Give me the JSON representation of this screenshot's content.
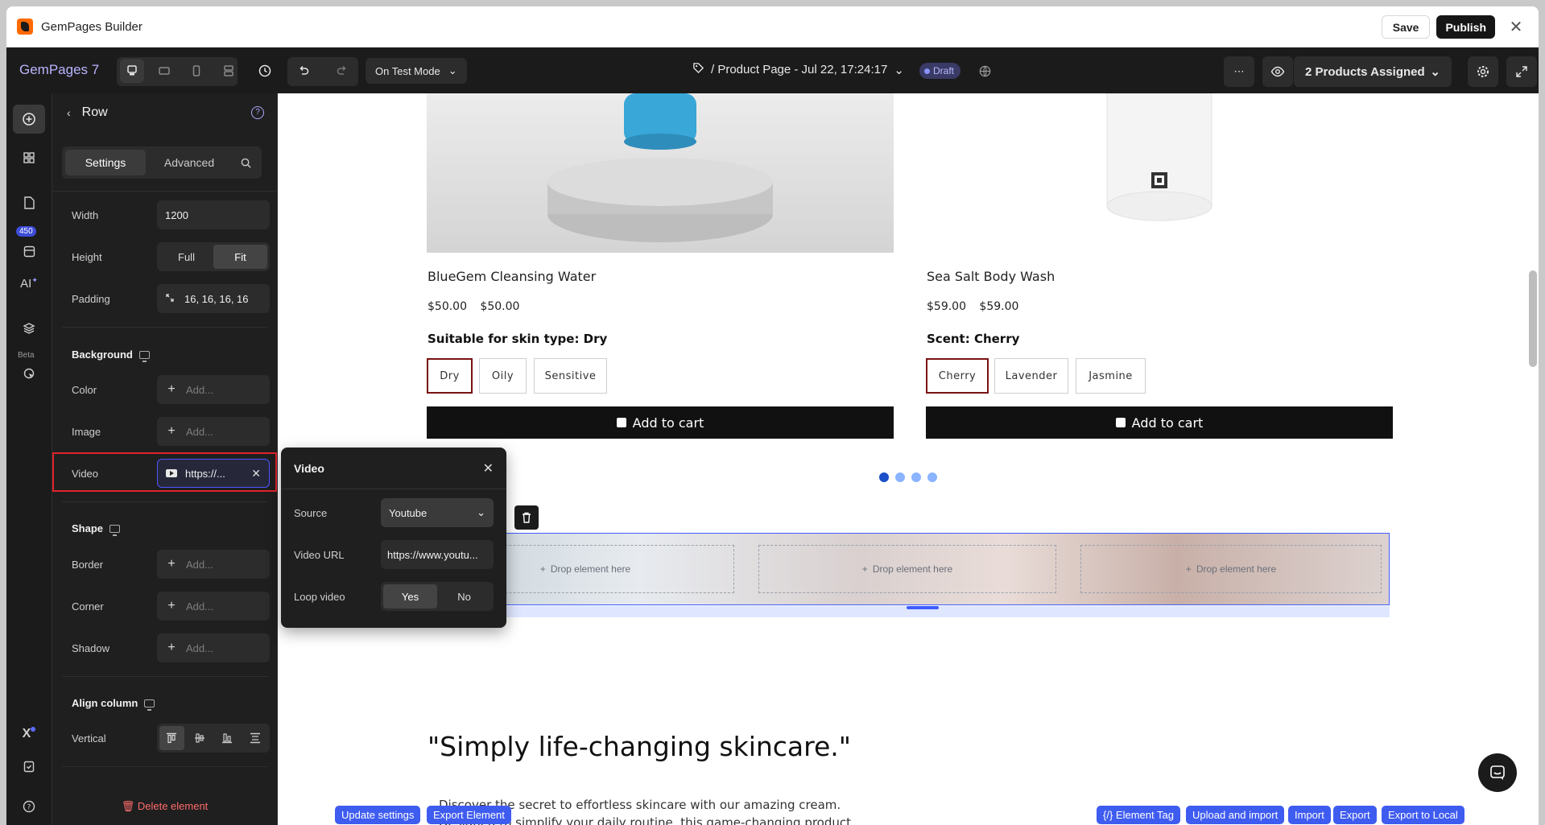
{
  "window": {
    "title": "GemPages Builder",
    "save_label": "Save",
    "publish_label": "Publish"
  },
  "toolbar": {
    "brand": "GemPages 7",
    "mode_label": "On Test Mode",
    "page_title": "/ Product Page - Jul 22, 17:24:17",
    "status_badge": "Draft",
    "products_assigned": "2 Products Assigned"
  },
  "rail": {
    "count_badge": "450",
    "ai_label": "AI",
    "beta_label": "Beta"
  },
  "panel": {
    "title": "Row",
    "tabs": [
      "Settings",
      "Advanced"
    ],
    "width_label": "Width",
    "width_value": "1200",
    "height_label": "Height",
    "height_options": [
      "Full",
      "Fit"
    ],
    "height_selected": "Fit",
    "padding_label": "Padding",
    "padding_value": "16, 16, 16, 16",
    "background_title": "Background",
    "color_label": "Color",
    "image_label": "Image",
    "add_placeholder": "Add...",
    "video_label": "Video",
    "video_value": "https://...",
    "shape_title": "Shape",
    "border_label": "Border",
    "corner_label": "Corner",
    "shadow_label": "Shadow",
    "align_title": "Align column",
    "vertical_label": "Vertical",
    "delete_label": "Delete element"
  },
  "video_popover": {
    "title": "Video",
    "source_label": "Source",
    "source_value": "Youtube",
    "url_label": "Video URL",
    "url_value": "https://www.youtu...",
    "loop_label": "Loop video",
    "loop_options": [
      "Yes",
      "No"
    ],
    "loop_selected": "Yes"
  },
  "products": [
    {
      "name": "BlueGem Cleansing Water",
      "price": "$50.00 $50.00",
      "option_title": "Suitable for skin type: Dry",
      "options": [
        "Dry",
        "Oily",
        "Sensitive"
      ],
      "selected": "Dry",
      "cta": "Add to cart"
    },
    {
      "name": "Sea Salt Body Wash",
      "price": "$59.00 $59.00",
      "option_title": "Scent: Cherry",
      "options": [
        "Cherry",
        "Lavender",
        "Jasmine"
      ],
      "selected": "Cherry",
      "cta": "Add to cart"
    }
  ],
  "carousel": {
    "pages": 4,
    "current": 1
  },
  "row_block": {
    "drop_label": "Drop element here"
  },
  "testimonial": {
    "quote": "\"Simply life-changing skincare.\"",
    "desc": "Discover the secret to effortless skincare with our amazing cream. Designed to simplify your daily routine, this game-changing product delivers remarkable"
  },
  "bottom_actions": {
    "update_settings": "Update settings",
    "export_element": "Export Element",
    "element_tag": "{/} Element Tag",
    "upload_import": "Upload and import",
    "import": "Import",
    "export": "Export",
    "export_local": "Export to Local"
  }
}
